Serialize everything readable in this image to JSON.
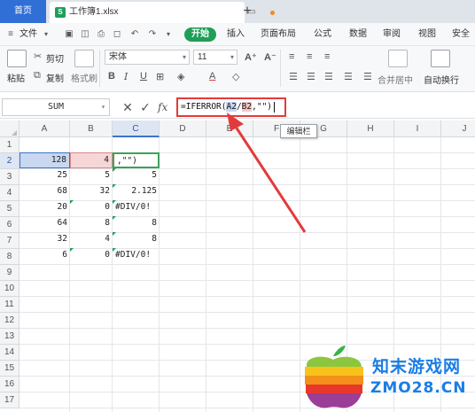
{
  "tabs": {
    "home_label": "首页",
    "file_label": "工作簿1.xlsx",
    "new_tab_label": "+"
  },
  "menu": {
    "file_menu": "文件",
    "start": "开始",
    "items": [
      "插入",
      "页面布局",
      "公式",
      "数据",
      "审阅",
      "视图",
      "安全"
    ]
  },
  "ribbon": {
    "paste": "粘贴",
    "cut": "剪切",
    "copy": "复制",
    "format_painter": "格式刷",
    "font_name": "宋体",
    "font_size": "11",
    "merge_center": "合并居中",
    "wrap_text": "自动换行"
  },
  "formula_bar": {
    "name_box": "SUM",
    "formula_prefix": "=IFERROR(",
    "ref_a": "A2",
    "slash": "/",
    "ref_b": "B2",
    "formula_suffix": ",\"\")",
    "tooltip": "编辑栏"
  },
  "grid": {
    "columns": [
      "A",
      "B",
      "C",
      "D",
      "E",
      "F",
      "G",
      "H",
      "I",
      "J"
    ],
    "rows": [
      "1",
      "2",
      "3",
      "4",
      "5",
      "6",
      "7",
      "8",
      "9",
      "10",
      "11",
      "12",
      "13",
      "14",
      "15",
      "16",
      "17"
    ],
    "active_cell": "C2",
    "data": {
      "A": [
        "128",
        "25",
        "68",
        "20",
        "64",
        "32",
        "6"
      ],
      "B": [
        "4",
        "5",
        "32",
        "0",
        "8",
        "4",
        "0"
      ],
      "C": [
        ",\"\")",
        "5",
        "2.125",
        "#DIV/0!",
        "8",
        "8",
        "#DIV/0!"
      ]
    }
  },
  "watermark": {
    "title": "知末游戏网",
    "url": "ZMO28.CN"
  },
  "colors": {
    "accent_blue": "#2f6fd6",
    "start_green": "#1f9e57",
    "highlight_red": "#e23b3b",
    "watermark_blue": "#1a7de6"
  }
}
